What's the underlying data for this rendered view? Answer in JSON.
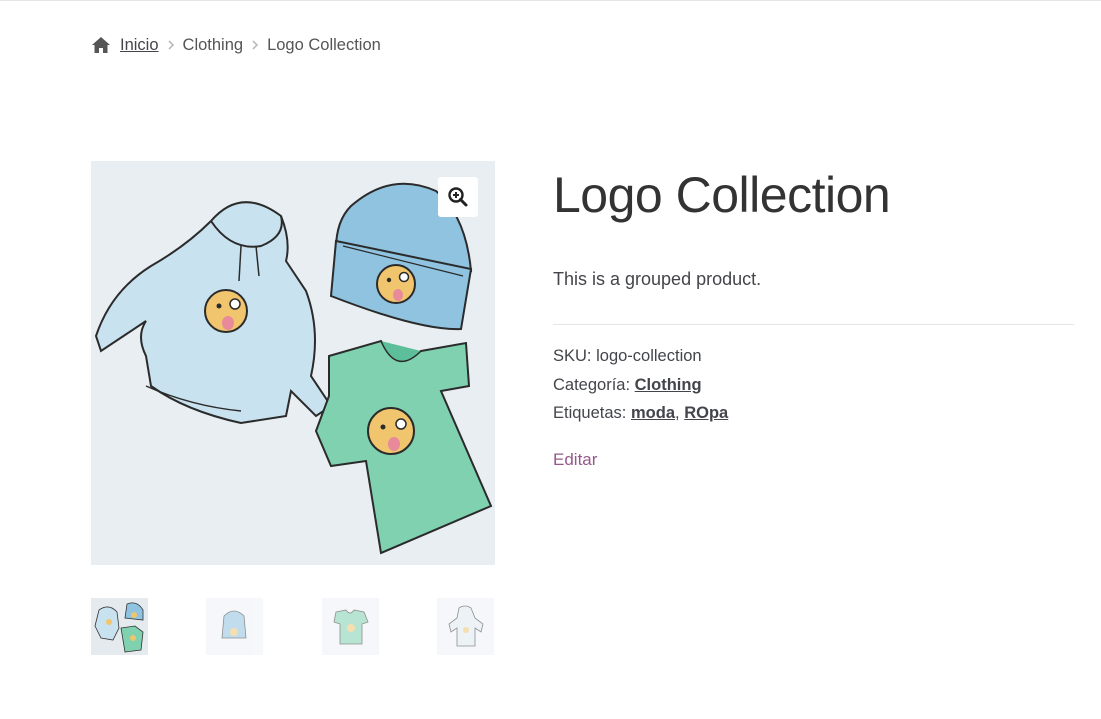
{
  "breadcrumb": {
    "home_icon": "home-icon",
    "home_label": "Inicio",
    "items": [
      "Clothing",
      "Logo Collection"
    ]
  },
  "product": {
    "title": "Logo Collection",
    "description": "This is a grouped product.",
    "sku_label": "SKU:",
    "sku_value": "logo-collection",
    "category_label": "Categoría:",
    "category_value": "Clothing",
    "tags_label": "Etiquetas:",
    "tags": [
      "moda",
      "ROpa"
    ],
    "tag_separator": ",",
    "edit_label": "Editar"
  },
  "gallery": {
    "zoom_icon": "zoom-in-icon",
    "thumbnails": [
      "logo-collection",
      "beanie",
      "t-shirt",
      "hoodie"
    ]
  },
  "colors": {
    "link_accent": "#96588a",
    "text": "#43454b",
    "hoodie": "#c9e2ef",
    "beanie": "#8fc3df",
    "tshirt": "#7fd1b0",
    "emoji": "#f0c56d"
  }
}
